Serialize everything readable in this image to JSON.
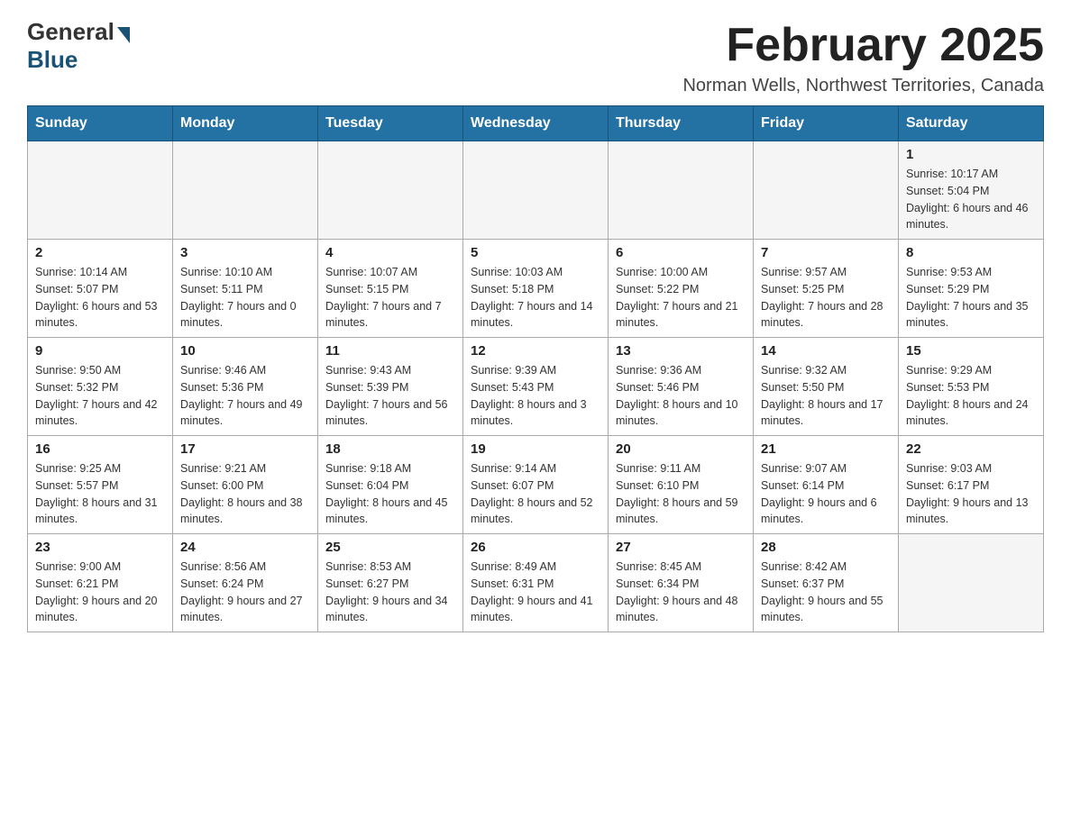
{
  "header": {
    "logo_general": "General",
    "logo_blue": "Blue",
    "main_title": "February 2025",
    "subtitle": "Norman Wells, Northwest Territories, Canada"
  },
  "days_of_week": [
    "Sunday",
    "Monday",
    "Tuesday",
    "Wednesday",
    "Thursday",
    "Friday",
    "Saturday"
  ],
  "weeks": [
    [
      {
        "day": "",
        "info": ""
      },
      {
        "day": "",
        "info": ""
      },
      {
        "day": "",
        "info": ""
      },
      {
        "day": "",
        "info": ""
      },
      {
        "day": "",
        "info": ""
      },
      {
        "day": "",
        "info": ""
      },
      {
        "day": "1",
        "info": "Sunrise: 10:17 AM\nSunset: 5:04 PM\nDaylight: 6 hours and 46 minutes."
      }
    ],
    [
      {
        "day": "2",
        "info": "Sunrise: 10:14 AM\nSunset: 5:07 PM\nDaylight: 6 hours and 53 minutes."
      },
      {
        "day": "3",
        "info": "Sunrise: 10:10 AM\nSunset: 5:11 PM\nDaylight: 7 hours and 0 minutes."
      },
      {
        "day": "4",
        "info": "Sunrise: 10:07 AM\nSunset: 5:15 PM\nDaylight: 7 hours and 7 minutes."
      },
      {
        "day": "5",
        "info": "Sunrise: 10:03 AM\nSunset: 5:18 PM\nDaylight: 7 hours and 14 minutes."
      },
      {
        "day": "6",
        "info": "Sunrise: 10:00 AM\nSunset: 5:22 PM\nDaylight: 7 hours and 21 minutes."
      },
      {
        "day": "7",
        "info": "Sunrise: 9:57 AM\nSunset: 5:25 PM\nDaylight: 7 hours and 28 minutes."
      },
      {
        "day": "8",
        "info": "Sunrise: 9:53 AM\nSunset: 5:29 PM\nDaylight: 7 hours and 35 minutes."
      }
    ],
    [
      {
        "day": "9",
        "info": "Sunrise: 9:50 AM\nSunset: 5:32 PM\nDaylight: 7 hours and 42 minutes."
      },
      {
        "day": "10",
        "info": "Sunrise: 9:46 AM\nSunset: 5:36 PM\nDaylight: 7 hours and 49 minutes."
      },
      {
        "day": "11",
        "info": "Sunrise: 9:43 AM\nSunset: 5:39 PM\nDaylight: 7 hours and 56 minutes."
      },
      {
        "day": "12",
        "info": "Sunrise: 9:39 AM\nSunset: 5:43 PM\nDaylight: 8 hours and 3 minutes."
      },
      {
        "day": "13",
        "info": "Sunrise: 9:36 AM\nSunset: 5:46 PM\nDaylight: 8 hours and 10 minutes."
      },
      {
        "day": "14",
        "info": "Sunrise: 9:32 AM\nSunset: 5:50 PM\nDaylight: 8 hours and 17 minutes."
      },
      {
        "day": "15",
        "info": "Sunrise: 9:29 AM\nSunset: 5:53 PM\nDaylight: 8 hours and 24 minutes."
      }
    ],
    [
      {
        "day": "16",
        "info": "Sunrise: 9:25 AM\nSunset: 5:57 PM\nDaylight: 8 hours and 31 minutes."
      },
      {
        "day": "17",
        "info": "Sunrise: 9:21 AM\nSunset: 6:00 PM\nDaylight: 8 hours and 38 minutes."
      },
      {
        "day": "18",
        "info": "Sunrise: 9:18 AM\nSunset: 6:04 PM\nDaylight: 8 hours and 45 minutes."
      },
      {
        "day": "19",
        "info": "Sunrise: 9:14 AM\nSunset: 6:07 PM\nDaylight: 8 hours and 52 minutes."
      },
      {
        "day": "20",
        "info": "Sunrise: 9:11 AM\nSunset: 6:10 PM\nDaylight: 8 hours and 59 minutes."
      },
      {
        "day": "21",
        "info": "Sunrise: 9:07 AM\nSunset: 6:14 PM\nDaylight: 9 hours and 6 minutes."
      },
      {
        "day": "22",
        "info": "Sunrise: 9:03 AM\nSunset: 6:17 PM\nDaylight: 9 hours and 13 minutes."
      }
    ],
    [
      {
        "day": "23",
        "info": "Sunrise: 9:00 AM\nSunset: 6:21 PM\nDaylight: 9 hours and 20 minutes."
      },
      {
        "day": "24",
        "info": "Sunrise: 8:56 AM\nSunset: 6:24 PM\nDaylight: 9 hours and 27 minutes."
      },
      {
        "day": "25",
        "info": "Sunrise: 8:53 AM\nSunset: 6:27 PM\nDaylight: 9 hours and 34 minutes."
      },
      {
        "day": "26",
        "info": "Sunrise: 8:49 AM\nSunset: 6:31 PM\nDaylight: 9 hours and 41 minutes."
      },
      {
        "day": "27",
        "info": "Sunrise: 8:45 AM\nSunset: 6:34 PM\nDaylight: 9 hours and 48 minutes."
      },
      {
        "day": "28",
        "info": "Sunrise: 8:42 AM\nSunset: 6:37 PM\nDaylight: 9 hours and 55 minutes."
      },
      {
        "day": "",
        "info": ""
      }
    ]
  ]
}
